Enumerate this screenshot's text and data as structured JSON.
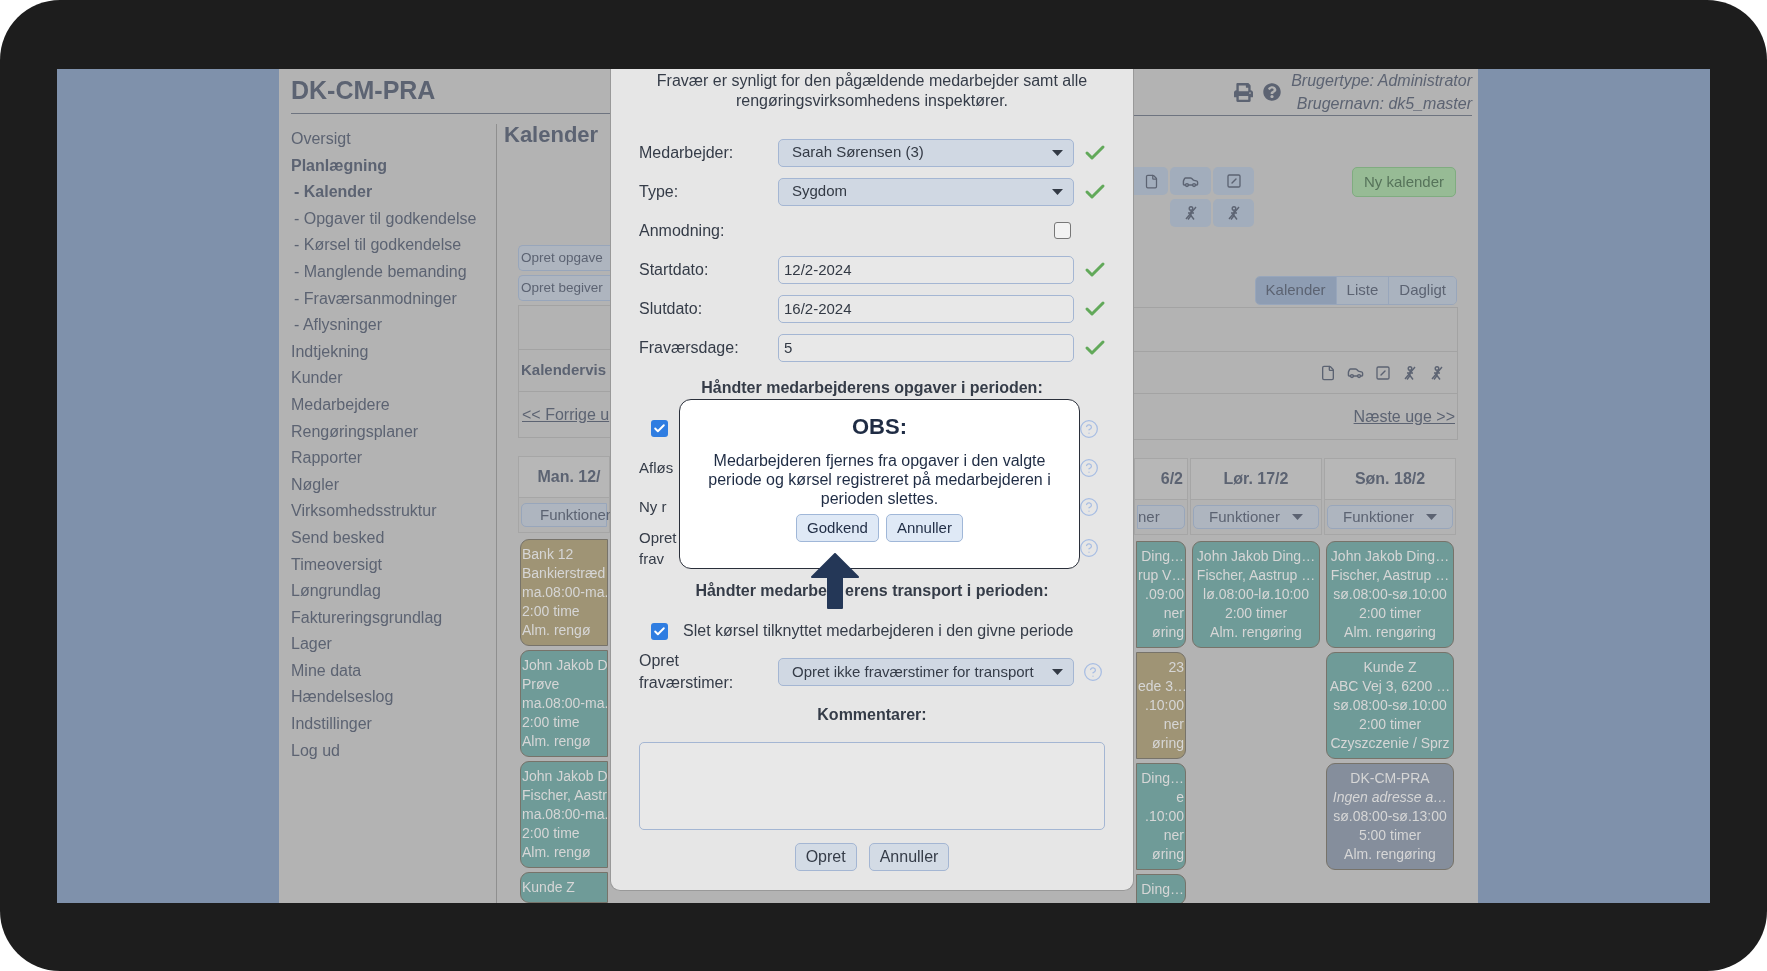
{
  "app": {
    "title": "DK-CM-PRA",
    "user_type": "Brugertype: Administrator",
    "username": "Brugernavn: dk5_master"
  },
  "sidebar": {
    "items": [
      {
        "label": "Oversigt",
        "selected": false
      },
      {
        "label": "Planlægning",
        "selected": true,
        "children": [
          {
            "label": "- Kalender",
            "selected": true
          },
          {
            "label": "- Opgaver til godkendelse",
            "selected": false
          },
          {
            "label": "- Kørsel til godkendelse",
            "selected": false
          },
          {
            "label": "- Manglende bemanding",
            "selected": false
          },
          {
            "label": "- Fraværsanmodninger",
            "selected": false
          },
          {
            "label": "- Aflysninger",
            "selected": false
          }
        ]
      },
      {
        "label": "Indtjekning",
        "selected": false
      },
      {
        "label": "Kunder",
        "selected": false
      },
      {
        "label": "Medarbejdere",
        "selected": false
      },
      {
        "label": "Rengøringsplaner",
        "selected": false
      },
      {
        "label": "Rapporter",
        "selected": false
      },
      {
        "label": "Nøgler",
        "selected": false
      },
      {
        "label": "Virksomhedsstruktur",
        "selected": false
      },
      {
        "label": "Send besked",
        "selected": false
      },
      {
        "label": "Timeoversigt",
        "selected": false
      },
      {
        "label": "Løngrundlag",
        "selected": false
      },
      {
        "label": "Faktureringsgrundlag",
        "selected": false
      },
      {
        "label": "Lager",
        "selected": false
      },
      {
        "label": "Mine data",
        "selected": false
      },
      {
        "label": "Hændelseslog",
        "selected": false
      },
      {
        "label": "Indstillinger",
        "selected": false
      },
      {
        "label": "Log ud",
        "selected": false
      }
    ]
  },
  "page": {
    "title": "Kalender",
    "buttons": [
      "Opret opgave",
      "Opret begiver"
    ],
    "new_calendar": "Ny kalender",
    "view_tabs": [
      {
        "label": "Kalender",
        "selected": true
      },
      {
        "label": "Liste",
        "selected": false
      },
      {
        "label": "Dagligt",
        "selected": false
      }
    ],
    "section_label": "Kalendervis",
    "prev_week": "<< Forrige u",
    "next_week": "Næste uge >>"
  },
  "calendar": {
    "days": [
      {
        "kind": "start",
        "label": "Man. 12/",
        "menu": "Funktioner",
        "events": [
          {
            "color": "#9f9475",
            "title": "Bank 12",
            "address": "Bankierstræd",
            "time": "ma.08:00-ma.",
            "duration": "2:00 time",
            "service": "Alm. rengø"
          },
          {
            "color": "#6f9b98",
            "title": "John Jakob D",
            "address": "Prøve",
            "time": "ma.08:00-ma.",
            "duration": "2:00 time",
            "service": "Alm. rengø"
          },
          {
            "color": "#6f9b98",
            "title": "John Jakob D",
            "address": "Fischer, Aastr",
            "time": "ma.08:00-ma.",
            "duration": "2:00 time",
            "service": "Alm. rengø"
          },
          {
            "color": "#6f9b98",
            "title": "Kunde Z"
          }
        ]
      },
      {
        "kind": "end",
        "label": "6/2",
        "menu": "ner",
        "events": [
          {
            "color": "#6f9b98",
            "title": "Ding…",
            "address": "rup V…",
            "time": ".09:00",
            "duration": "ner",
            "service": "øring"
          },
          {
            "color": "#9f9475",
            "title": "23",
            "address": "ede 3…",
            "time": ".10:00",
            "duration": "ner",
            "service": "øring"
          },
          {
            "color": "#6f9b98",
            "title": "Ding…",
            "address": "e",
            "time": ".10:00",
            "duration": "ner",
            "service": "øring"
          },
          {
            "color": "#6f9b98",
            "title": "Ding…"
          }
        ]
      },
      {
        "kind": "whole",
        "label": "Lør. 17/2",
        "menu": "Funktioner",
        "events": [
          {
            "color": "#6f9b98",
            "title": "John Jakob Ding…",
            "address": "Fischer, Aastrup …",
            "time": "lø.08:00-lø.10:00",
            "duration": "2:00 timer",
            "service": "Alm. rengøring"
          }
        ]
      },
      {
        "kind": "whole",
        "label": "Søn. 18/2",
        "menu": "Funktioner",
        "events": [
          {
            "color": "#6f9b98",
            "title": "John Jakob Ding…",
            "address": "Fischer, Aastrup …",
            "time": "sø.08:00-sø.10:00",
            "duration": "2:00 timer",
            "service": "Alm. rengøring"
          },
          {
            "color": "#6f9b98",
            "title": "Kunde Z",
            "address": "ABC Vej 3, 6200 …",
            "time": "sø.08:00-sø.10:00",
            "duration": "2:00 timer",
            "service": "Czyszczenie / Sprz"
          },
          {
            "color": "#858e9c",
            "title": "DK-CM-PRA",
            "address": "Ingen adresse a…",
            "address_missing": true,
            "time": "sø.08:00-sø.13:00",
            "duration": "5:00 timer",
            "service": "Alm. rengøring"
          }
        ]
      }
    ]
  },
  "dialog": {
    "intro": "Fravær er synligt for den pågældende medarbejder samt alle rengøringsvirksomhedens inspektører.",
    "fields": [
      {
        "kind": "select",
        "label": "Medarbejder:",
        "value": "Sarah Sørensen (3)",
        "valid": true
      },
      {
        "kind": "select",
        "label": "Type:",
        "value": "Sygdom",
        "valid": true
      },
      {
        "kind": "checkbox",
        "label": "Anmodning:",
        "checked": false
      },
      {
        "kind": "text",
        "label": "Startdato:",
        "value": "12/2-2024",
        "valid": true
      },
      {
        "kind": "text",
        "label": "Slutdato:",
        "value": "16/2-2024",
        "valid": true
      },
      {
        "kind": "text",
        "label": "Fraværsdage:",
        "value": "5",
        "valid": true
      }
    ],
    "tasks_heading": "Håndter medarbejderens opgaver i perioden:",
    "task_rows": [
      {
        "kind": "checkbox",
        "checked": true
      },
      {
        "kind": "label",
        "label": [
          "Afløs"
        ]
      },
      {
        "kind": "label",
        "label": [
          "Ny r"
        ]
      },
      {
        "kind": "label",
        "label": [
          "Opret",
          "frav"
        ]
      }
    ],
    "transport_heading": [
      "Håndter medarbe",
      "erens transport i perioden:"
    ],
    "delete_driving": {
      "label": "Slet kørsel tilknyttet medarbejderen i den givne periode",
      "checked": true
    },
    "absence_hours": {
      "label": "Opret fraværstimer:",
      "value": "Opret ikke fraværstimer for transport"
    },
    "comments_label": "Kommentarer:",
    "buttons": [
      "Opret",
      "Annuller"
    ]
  },
  "confirm": {
    "title": "OBS:",
    "message": "Medarbejderen fjernes fra opgaver i den valgte periode og kørsel registreret på medarbejderen i perioden slettes.",
    "buttons": [
      "Godkend",
      "Annuller"
    ]
  }
}
